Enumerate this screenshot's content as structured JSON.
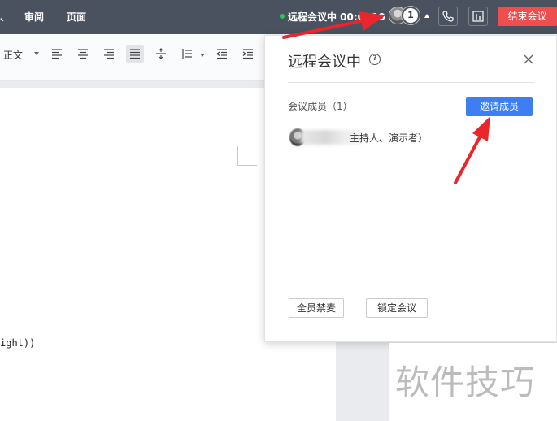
{
  "topbar": {
    "menu_partial": "、",
    "menu_review": "审阅",
    "menu_page": "页面",
    "meeting_status": "远程会议中 00:0 :10",
    "member_count": "1",
    "end_button": "结束会议"
  },
  "toolbar": {
    "style_value": "正文",
    "icons": [
      "align-left-icon",
      "align-center-icon",
      "align-right-icon",
      "align-justify-icon",
      "line-spacing-icon",
      "paragraph-spacing-icon",
      "decrease-indent-icon",
      "increase-indent-icon"
    ]
  },
  "document": {
    "text_fragment": "ight))"
  },
  "panel": {
    "title": "远程会议中",
    "members_label": "会议成员（1）",
    "invite_button": "邀请成员",
    "member_role": "主持人、演示者）",
    "mute_all_button": "全员禁麦",
    "lock_button": "锁定会议"
  },
  "watermark": "软件技巧",
  "colors": {
    "topbar": "#4a5260",
    "end_button": "#ef4e4e",
    "invite_button": "#3d7ff0",
    "arrow": "#e8262b",
    "live_dot": "#2fc25b"
  }
}
